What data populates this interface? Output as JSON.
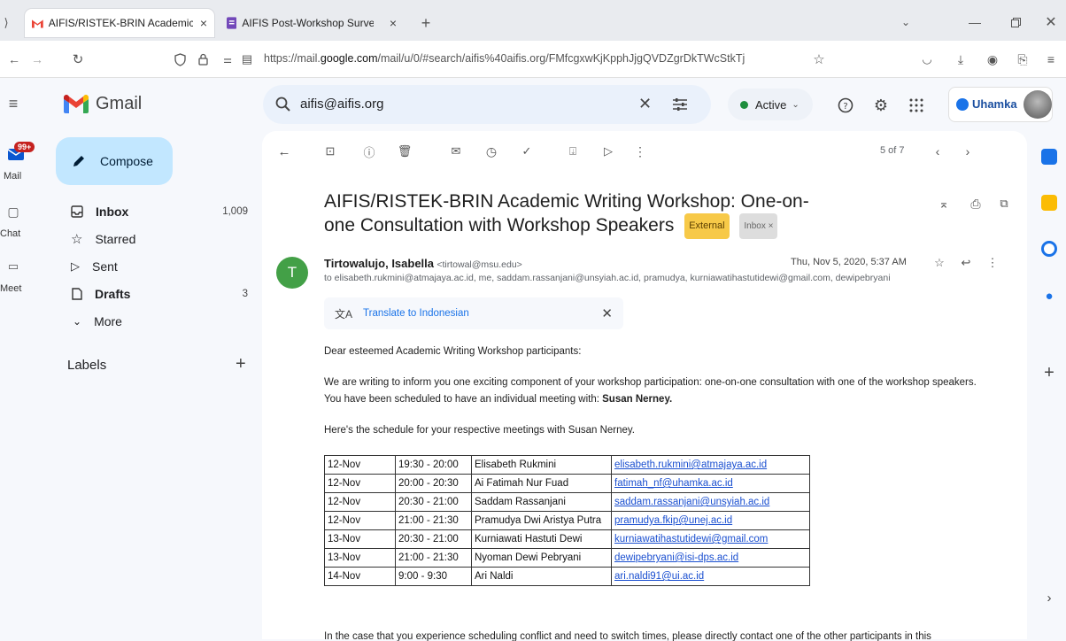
{
  "browser": {
    "tabs": [
      {
        "title": "AIFIS/RISTEK-BRIN Academic W",
        "close": "×"
      },
      {
        "title": "AIFIS Post-Workshop Survey",
        "close": "×"
      }
    ],
    "new_tab": "+",
    "url_domain_prefix": "https://mail.",
    "url_domain": "google.com",
    "url_path": "/mail/u/0/#search/aifis%40aifis.org/FMfcgxwKjKpphJjgQVDZgrDkTWcStkTj"
  },
  "gmail": {
    "logo_text": "Gmail",
    "search_query": "aifis@aifis.org",
    "status": "Active",
    "account_org": "Uhamka",
    "rail": {
      "mail_badge": "99+",
      "mail": "Mail",
      "chat": "Chat",
      "meet": "Meet"
    },
    "compose": "Compose",
    "nav": [
      {
        "label": "Inbox",
        "count": "1,009",
        "icon": "inbox-icon",
        "bold": true
      },
      {
        "label": "Starred",
        "count": "",
        "icon": "star-icon",
        "bold": false
      },
      {
        "label": "Sent",
        "count": "",
        "icon": "send-icon",
        "bold": false
      },
      {
        "label": "Drafts",
        "count": "3",
        "icon": "draft-icon",
        "bold": true
      },
      {
        "label": "More",
        "count": "",
        "icon": "chevron-down-icon",
        "bold": false
      }
    ],
    "labels_heading": "Labels",
    "labels_add": "+"
  },
  "email": {
    "pager": "5 of 7",
    "subject": "AIFIS/RISTEK-BRIN Academic Writing Workshop: One-on-one Consultation with Workshop Speakers",
    "badge_external": "External",
    "badge_inbox": "Inbox ×",
    "avatar_letter": "T",
    "sender_name": "Tirtowalujo, Isabella",
    "sender_email": "<tirtowal@msu.edu>",
    "date": "Thu, Nov 5, 2020, 5:37 AM",
    "recipients": "to elisabeth.rukmini@atmajaya.ac.id, me, saddam.rassanjani@unsyiah.ac.id, pramudya, kurniawatihastutidewi@gmail.com, dewipebryani@",
    "translate_label": "Translate to Indonesian",
    "greeting": "Dear esteemed Academic Writing Workshop participants:",
    "para1": "We are writing to inform you one exciting component of your workshop participation: one-on-one consultation with one of the workshop speakers. You have been scheduled to have an individual meeting with: ",
    "para1_bold": "Susan Nerney.",
    "schedule_intro": "Here's the schedule for your respective meetings with Susan Nerney.",
    "schedule": [
      {
        "date": "12-Nov",
        "time": "19:30 - 20:00",
        "name": "Elisabeth Rukmini",
        "email": "elisabeth.rukmini@atmajaya.ac.id"
      },
      {
        "date": "12-Nov",
        "time": "20:00 - 20:30",
        "name": "Ai Fatimah Nur Fuad",
        "email": "fatimah_nf@uhamka.ac.id"
      },
      {
        "date": "12-Nov",
        "time": "20:30 - 21:00",
        "name": "Saddam Rassanjani",
        "email": "saddam.rassanjani@unsyiah.ac.id"
      },
      {
        "date": "12-Nov",
        "time": "21:00 - 21:30",
        "name": "Pramudya Dwi Aristya Putra",
        "email": "pramudya.fkip@unej.ac.id"
      },
      {
        "date": "13-Nov",
        "time": "20:30 - 21:00",
        "name": "Kurniawati Hastuti Dewi",
        "email": "kurniawatihastutidewi@gmail.com"
      },
      {
        "date": "13-Nov",
        "time": "21:00 - 21:30",
        "name": "Nyoman Dewi Pebryani",
        "email": "dewipebryani@isi-dps.ac.id"
      },
      {
        "date": "14-Nov",
        "time": "9:00 - 9:30",
        "name": "Ari Naldi",
        "email": "ari.naldi91@ui.ac.id"
      }
    ],
    "cut_text": "In the case that you experience scheduling conflict and need to switch times, please directly contact one of the other participants in this"
  }
}
